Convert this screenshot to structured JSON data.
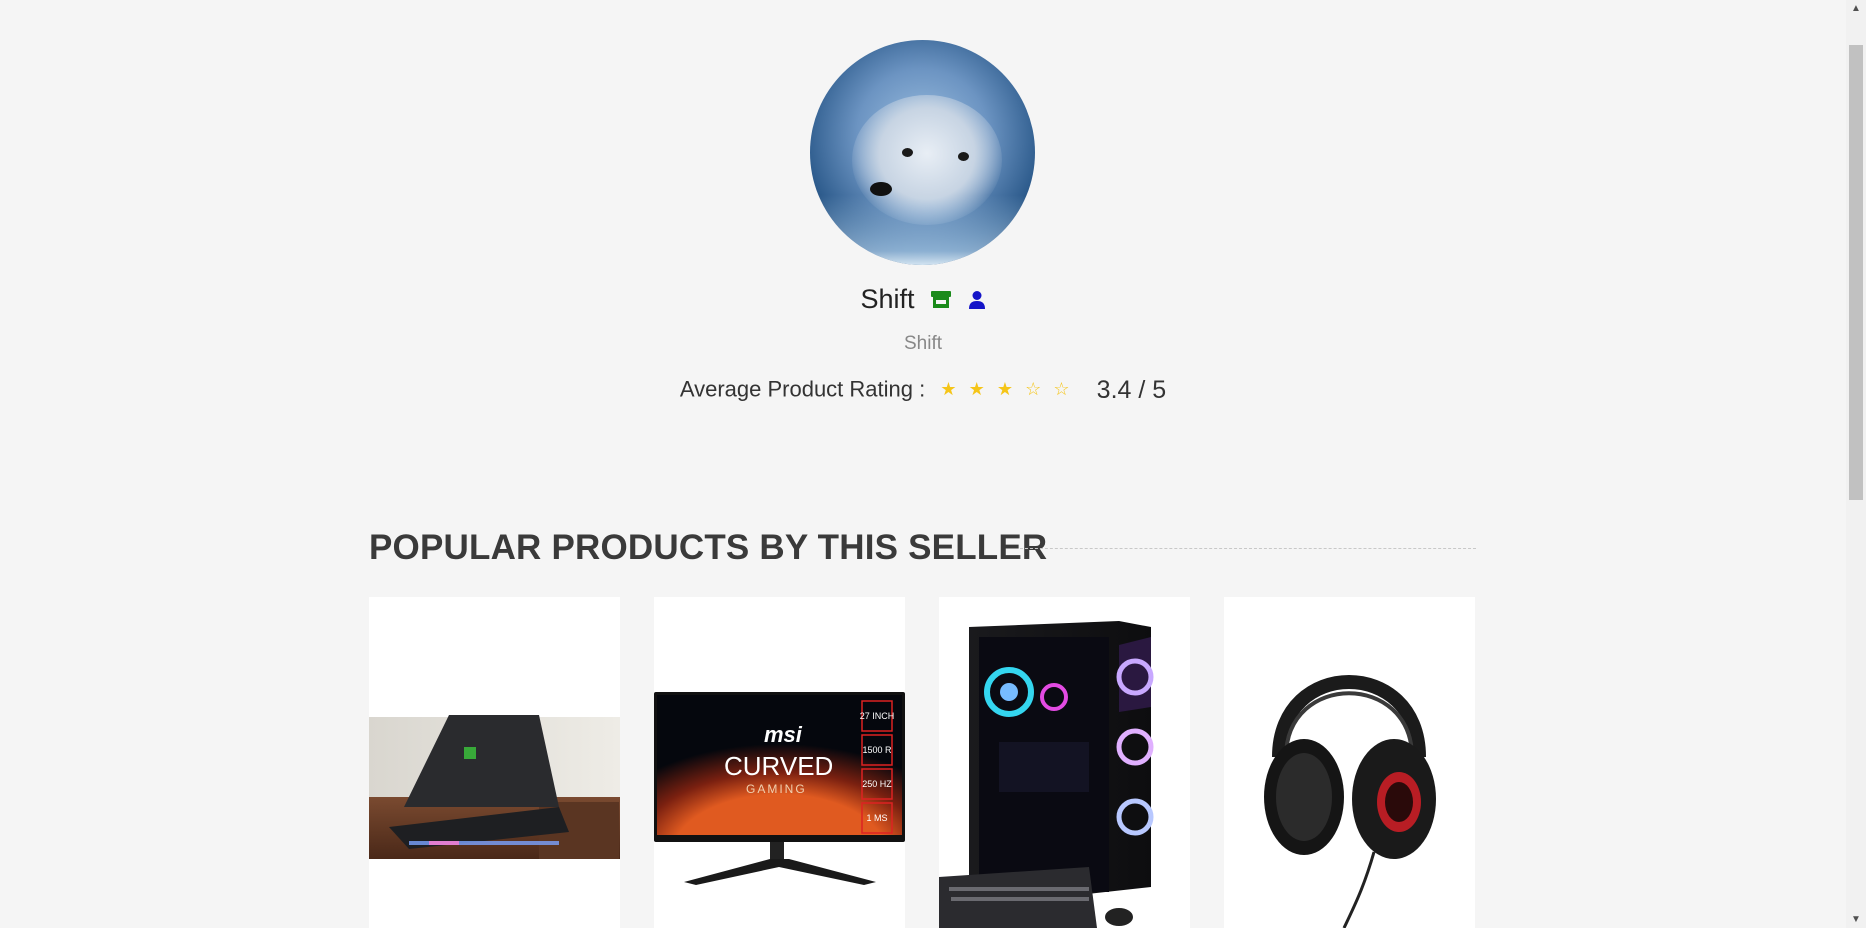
{
  "profile": {
    "name": "Shift",
    "username": "Shift",
    "rating_label": "Average Product Rating :",
    "rating_value": "3.4 / 5",
    "rating": 3.4,
    "rating_max": 5,
    "stars": [
      "★",
      "★",
      "★",
      "☆",
      "☆"
    ],
    "store_icon_color": "#1a8a1a",
    "user_icon_color": "#1414c8"
  },
  "section": {
    "title": "POPULAR PRODUCTS BY THIS SELLER"
  },
  "products": [
    {
      "image": "gaming-laptop-image"
    },
    {
      "image": "curved-gaming-monitor-image",
      "monitor_brand": "msi",
      "monitor_text": "CURVED",
      "monitor_sub": "GAMING",
      "specs": [
        "27 INCH",
        "1500 R",
        "250 HZ",
        "1 MS"
      ]
    },
    {
      "image": "gaming-desktop-pc-image"
    },
    {
      "image": "gaming-headset-image"
    }
  ],
  "scrollbar": {
    "up": "▲",
    "down": "▼"
  }
}
